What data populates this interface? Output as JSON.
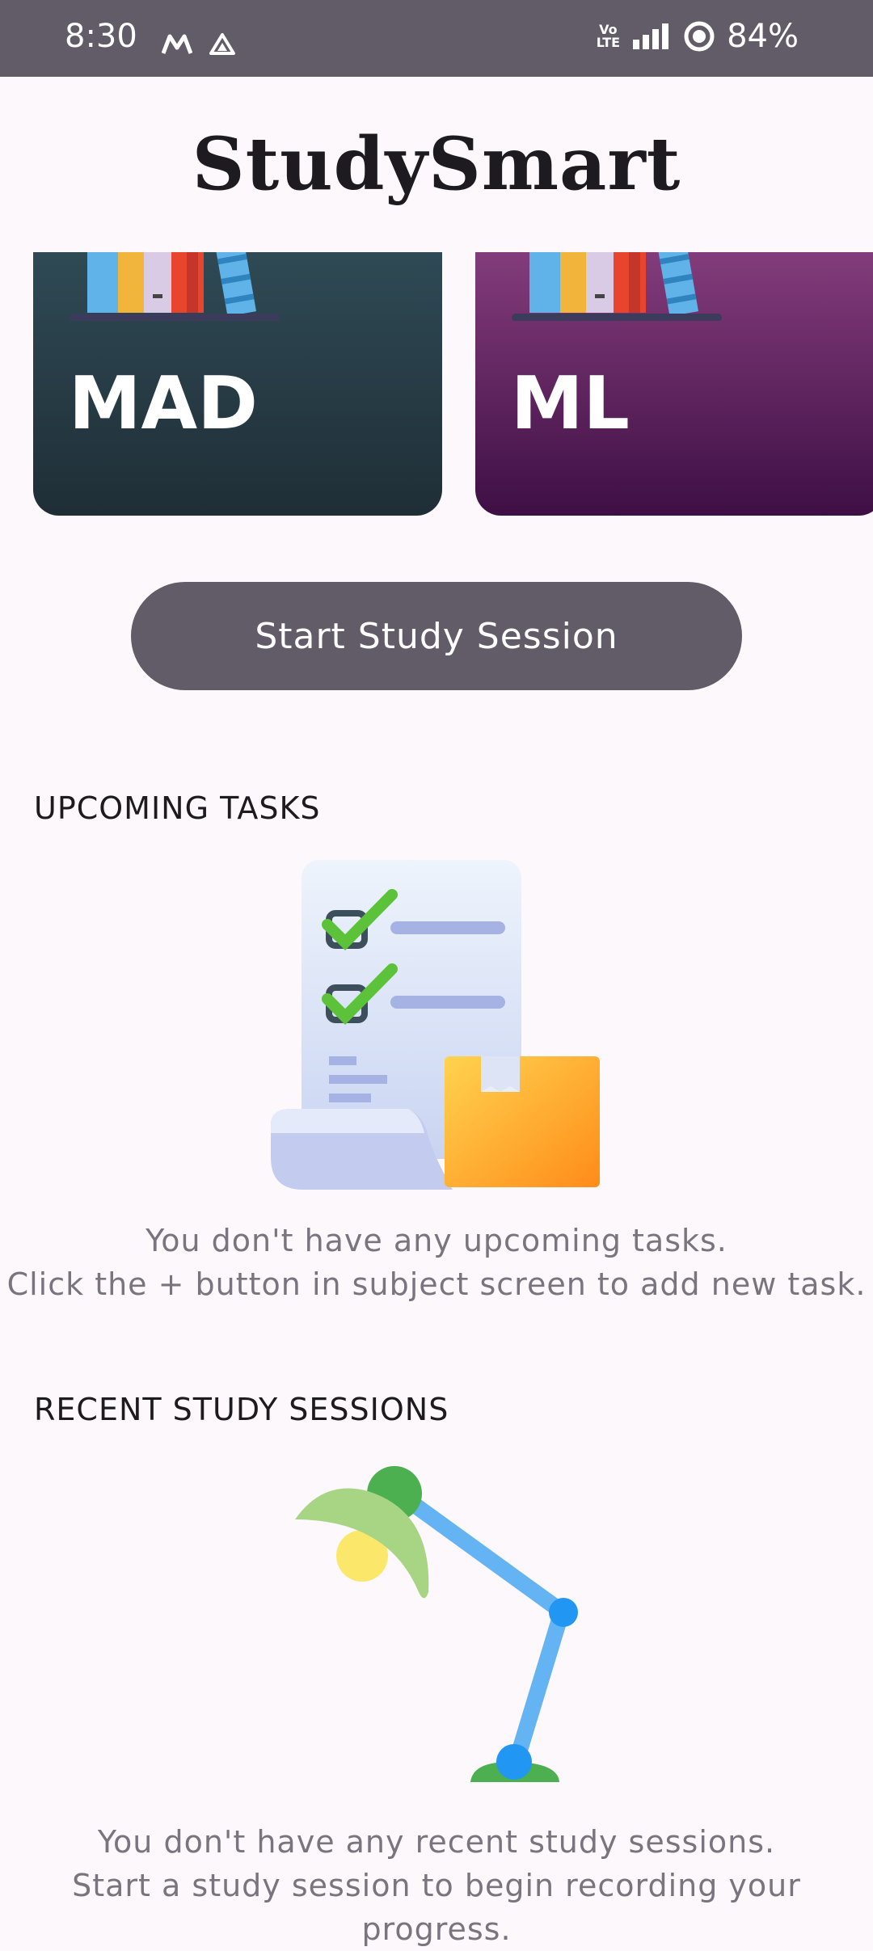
{
  "status_bar": {
    "time": "8:30",
    "battery": "84%",
    "network_label_top": "Vo",
    "network_label_bottom": "LTE",
    "icons": [
      "motorola-m-icon",
      "drive-icon",
      "volte-icon",
      "signal-icon",
      "battery-ring-icon"
    ]
  },
  "app": {
    "title": "StudySmart"
  },
  "subjects": [
    {
      "name": "MAD",
      "gradient_top": "#2f4a55",
      "gradient_bottom": "#1f2e36"
    },
    {
      "name": "ML",
      "gradient_top": "#833c7b",
      "gradient_bottom": "#3e0f45"
    }
  ],
  "actions": {
    "start_session_label": "Start Study Session"
  },
  "upcoming_tasks": {
    "heading": "UPCOMING TASKS",
    "empty_line_1": "You don't have any upcoming tasks.",
    "empty_line_2": "Click the + button in subject screen to add new task.",
    "illustration": "checklist-box-icon"
  },
  "recent_sessions": {
    "heading": "RECENT STUDY SESSIONS",
    "empty_line_1": "You don't have any recent study sessions.",
    "empty_line_2": "Start a study session to begin recording your",
    "empty_line_3": "progress.",
    "illustration": "desk-lamp-icon"
  },
  "colors": {
    "status_bar": "#625b68",
    "background": "#fdf8fc",
    "button": "#625b68",
    "muted_text": "#79747e"
  }
}
